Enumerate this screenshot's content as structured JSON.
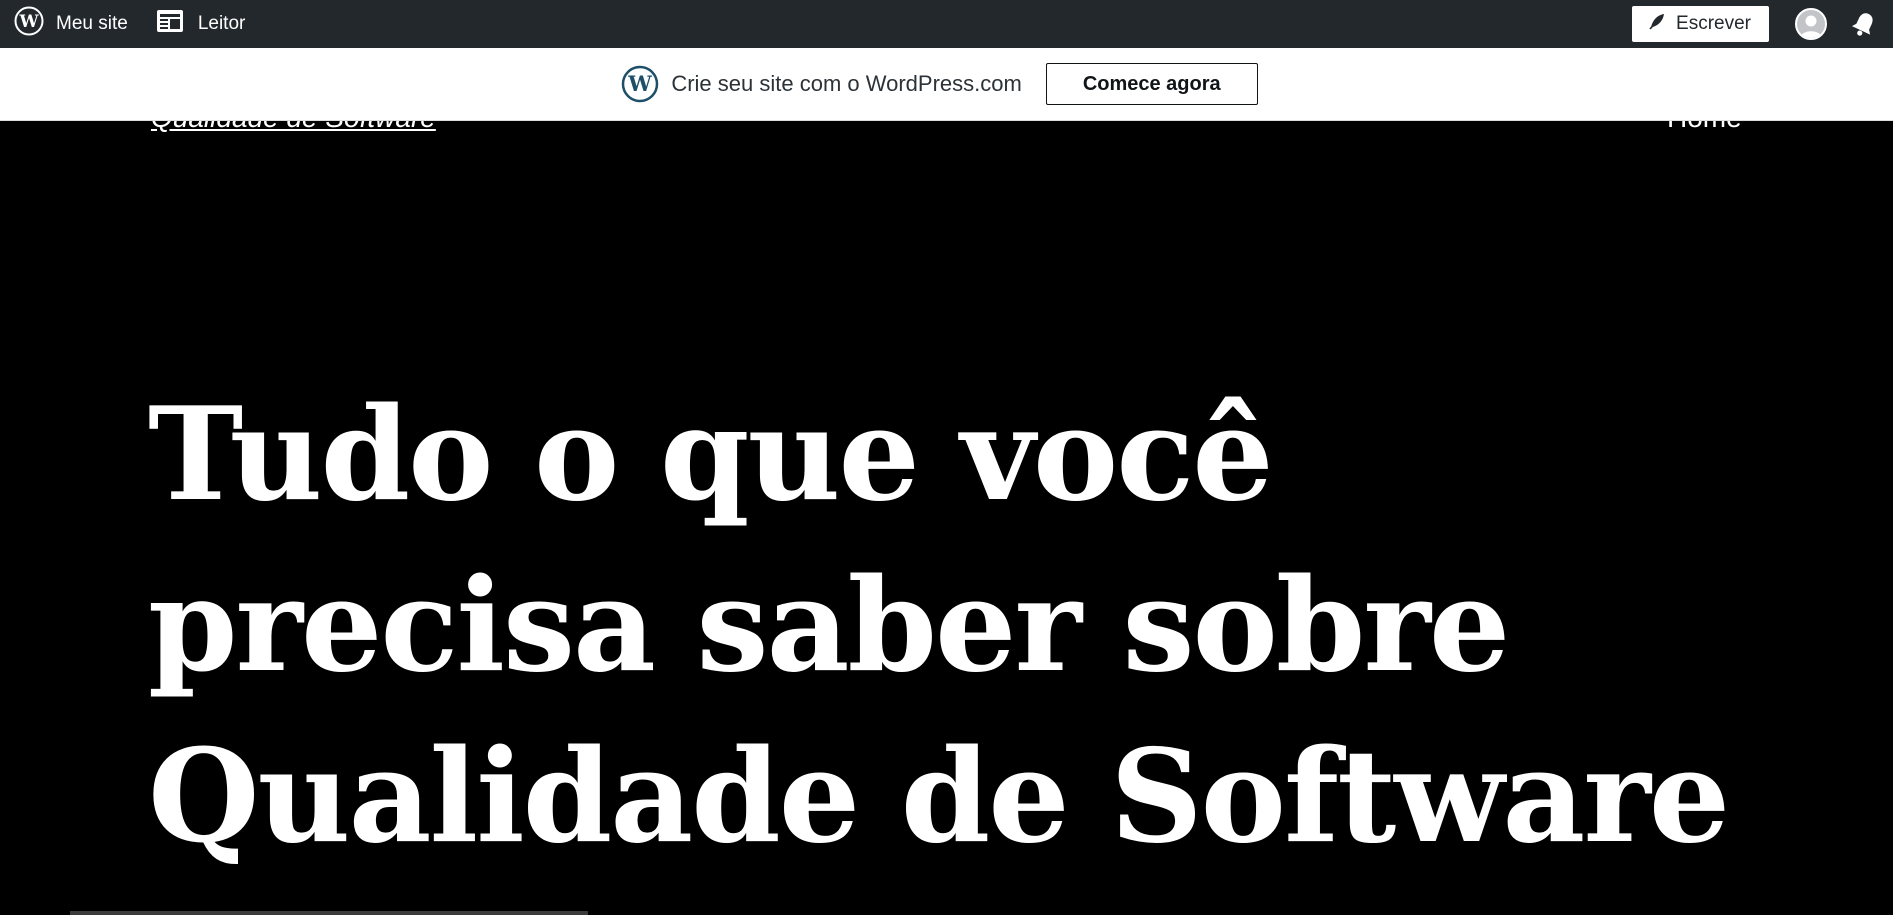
{
  "adminbar": {
    "my_site_label": "Meu site",
    "reader_label": "Leitor",
    "write_label": "Escrever",
    "icons": [
      "wordpress-icon",
      "reader-icon",
      "pen-icon",
      "avatar",
      "bell-icon"
    ],
    "colors": {
      "bar": "#23282d",
      "text": "#ffffff"
    }
  },
  "promo": {
    "text": "Crie seu site com o WordPress.com",
    "cta_label": "Comece agora"
  },
  "site": {
    "title": "Qualidade de Software",
    "nav": {
      "home_label": "Home"
    },
    "hero": {
      "lines": [
        "Tudo o que você",
        "precisa saber sobre",
        "Qualidade de Software"
      ]
    },
    "colors": {
      "background": "#000000",
      "text": "#ffffff"
    }
  }
}
